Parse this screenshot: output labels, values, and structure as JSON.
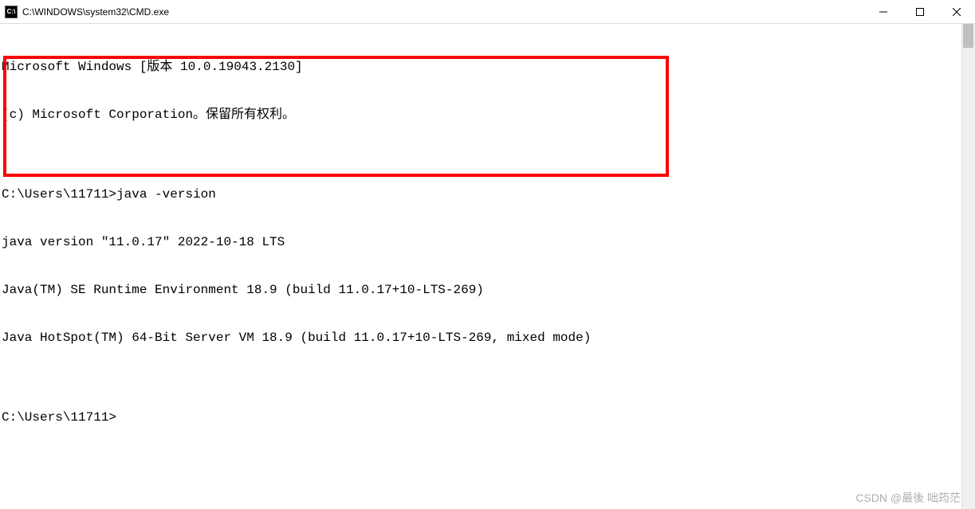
{
  "window": {
    "icon_label": "C:\\",
    "title": "C:\\WINDOWS\\system32\\CMD.exe"
  },
  "terminal": {
    "lines": [
      "Microsoft Windows [版本 10.0.19043.2130]",
      "(c) Microsoft Corporation。保留所有权利。",
      "",
      "C:\\Users\\11711>java -version",
      "java version \"11.0.17\" 2022-10-18 LTS",
      "Java(TM) SE Runtime Environment 18.9 (build 11.0.17+10-LTS-269)",
      "Java HotSpot(TM) 64-Bit Server VM 18.9 (build 11.0.17+10-LTS-269, mixed mode)",
      "",
      "C:\\Users\\11711>"
    ]
  },
  "watermark": "CSDN @最後 咄筠茫"
}
